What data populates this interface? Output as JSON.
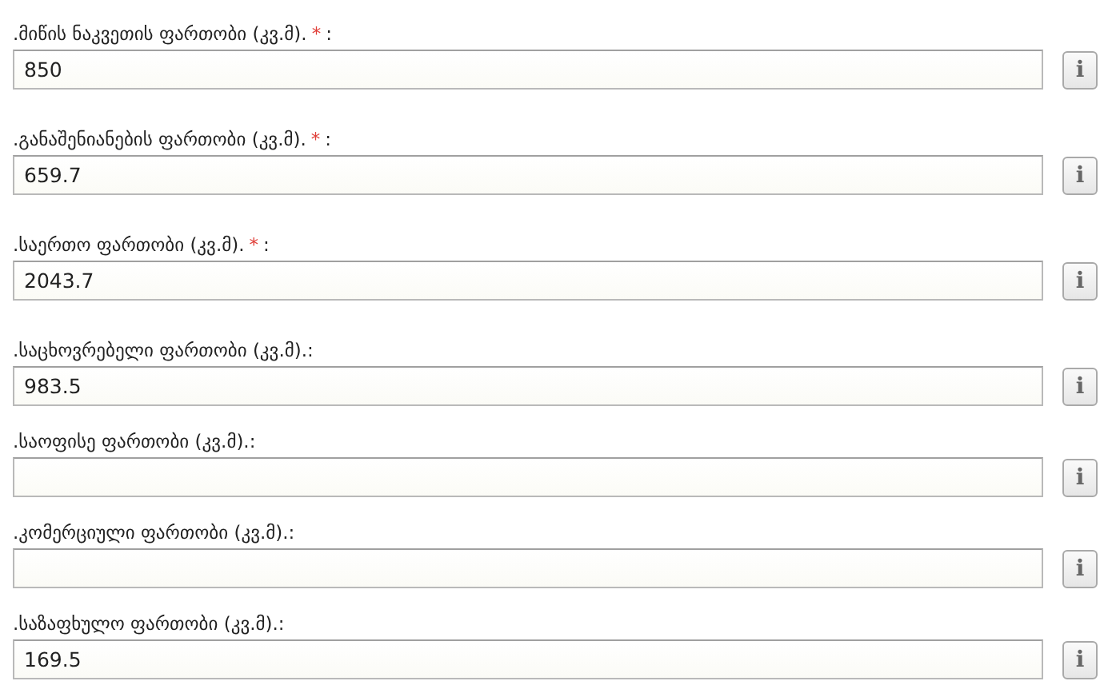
{
  "fields": [
    {
      "label": ".მიწის ნაკვეთის ფართობი (კვ.მ).",
      "required": true,
      "mark": "*",
      "colon": ":",
      "value": "850",
      "info": "i"
    },
    {
      "label": ".განაშენიანების ფართობი (კვ.მ).",
      "required": true,
      "mark": "*",
      "colon": ":",
      "value": "659.7",
      "info": "i"
    },
    {
      "label": ".საერთო ფართობი (კვ.მ).",
      "required": true,
      "mark": "*",
      "colon": ":",
      "value": "2043.7",
      "info": "i"
    },
    {
      "label": ".საცხოვრებელი ფართობი (კვ.მ).",
      "required": false,
      "colon": ":",
      "value": "983.5",
      "info": "i"
    },
    {
      "label": ".საოფისე ფართობი (კვ.მ).",
      "required": false,
      "colon": ":",
      "info": "i"
    },
    {
      "label": ".კომერციული ფართობი (კვ.მ).",
      "required": false,
      "colon": ":",
      "info": "i"
    },
    {
      "label": ".საზაფხულო ფართობი (კვ.მ).",
      "required": false,
      "colon": ":",
      "value": "169.5",
      "info": "i"
    }
  ]
}
